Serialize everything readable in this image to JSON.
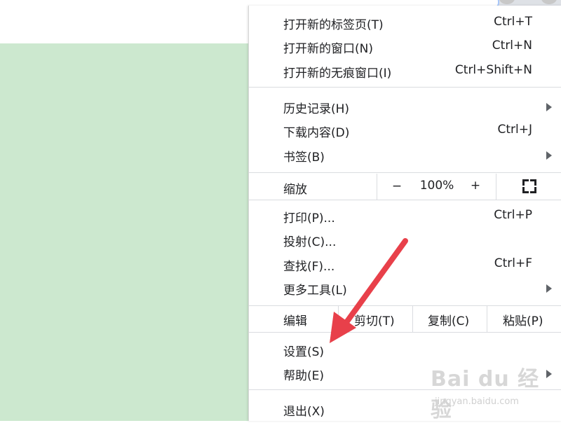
{
  "menu": {
    "new_tab": {
      "label": "打开新的标签页(T)",
      "shortcut": "Ctrl+T"
    },
    "new_window": {
      "label": "打开新的窗口(N)",
      "shortcut": "Ctrl+N"
    },
    "new_incognito": {
      "label": "打开新的无痕窗口(I)",
      "shortcut": "Ctrl+Shift+N"
    },
    "history": {
      "label": "历史记录(H)"
    },
    "downloads": {
      "label": "下载内容(D)",
      "shortcut": "Ctrl+J"
    },
    "bookmarks": {
      "label": "书签(B)"
    },
    "zoom": {
      "label": "缩放",
      "minus": "−",
      "value": "100%",
      "plus": "+"
    },
    "print": {
      "label": "打印(P)...",
      "shortcut": "Ctrl+P"
    },
    "cast": {
      "label": "投射(C)..."
    },
    "find": {
      "label": "查找(F)...",
      "shortcut": "Ctrl+F"
    },
    "more_tools": {
      "label": "更多工具(L)"
    },
    "edit": {
      "label": "编辑",
      "cut": "剪切(T)",
      "copy": "复制(C)",
      "paste": "粘贴(P)"
    },
    "settings": {
      "label": "设置(S)"
    },
    "help": {
      "label": "帮助(E)"
    },
    "exit": {
      "label": "退出(X)"
    }
  },
  "watermark": {
    "brand": "Bai du 经验",
    "url": "jingyan.baidu.com"
  },
  "colors": {
    "page_background": "#cce8cf",
    "annotation_arrow": "#e8404a"
  },
  "icons": [
    "submenu-arrow-icon",
    "fullscreen-icon",
    "annotation-arrow"
  ]
}
